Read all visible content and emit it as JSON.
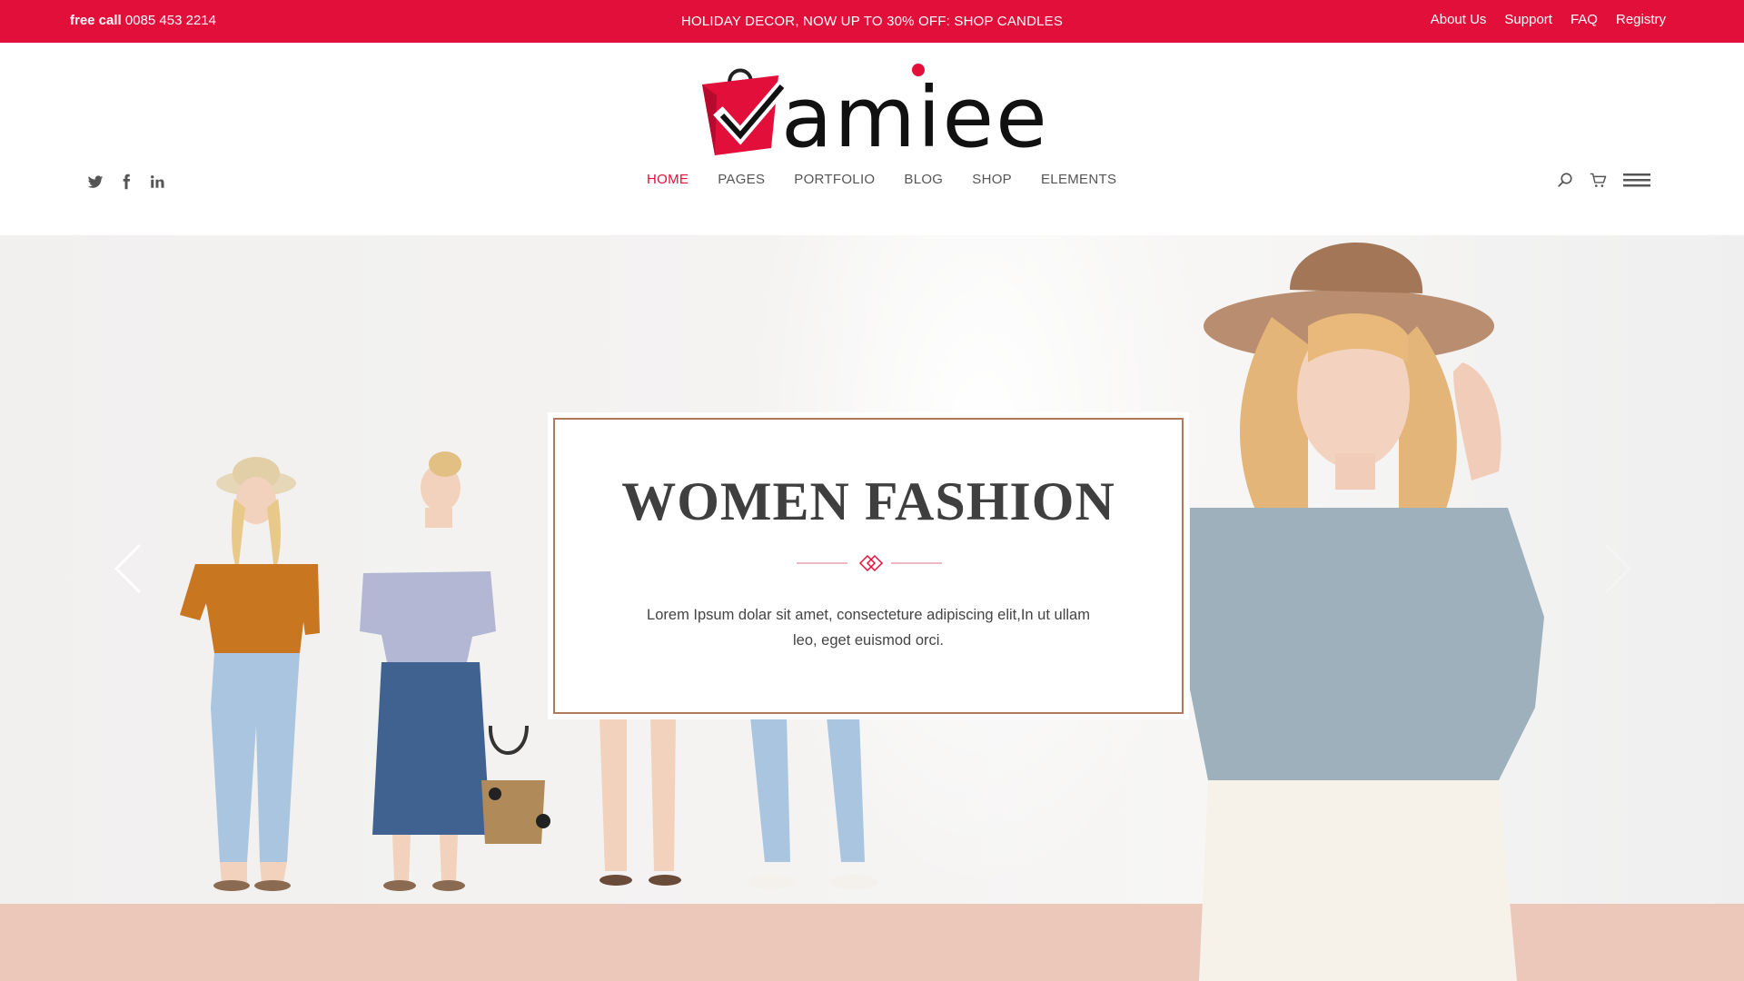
{
  "topbar": {
    "phone_label": "free call",
    "phone_number": "0085 453 2214",
    "promo": "HOLIDAY DECOR, NOW UP TO 30% OFF: SHOP CANDLES",
    "links": [
      "About Us",
      "Support",
      "FAQ",
      "Registry"
    ]
  },
  "header": {
    "logo_text": "amiee",
    "social_icons": [
      "twitter-icon",
      "facebook-icon",
      "linkedin-icon"
    ],
    "nav": [
      "HOME",
      "PAGES",
      "PORTFOLIO",
      "BLOG",
      "SHOP",
      "ELEMENTS"
    ],
    "active_nav": "HOME",
    "tools": [
      "search-icon",
      "cart-icon",
      "menu-icon"
    ]
  },
  "hero": {
    "title": "WOMEN FASHION",
    "description": "Lorem Ipsum dolar sit amet, consecteture adipiscing elit,In ut ullam leo, eget euismod orci.",
    "prev_icon": "chevron-left-icon",
    "next_icon": "chevron-right-icon"
  },
  "colors": {
    "accent": "#e20f3b",
    "card_border": "#b07a5a",
    "floor": "#ebc8b9"
  }
}
